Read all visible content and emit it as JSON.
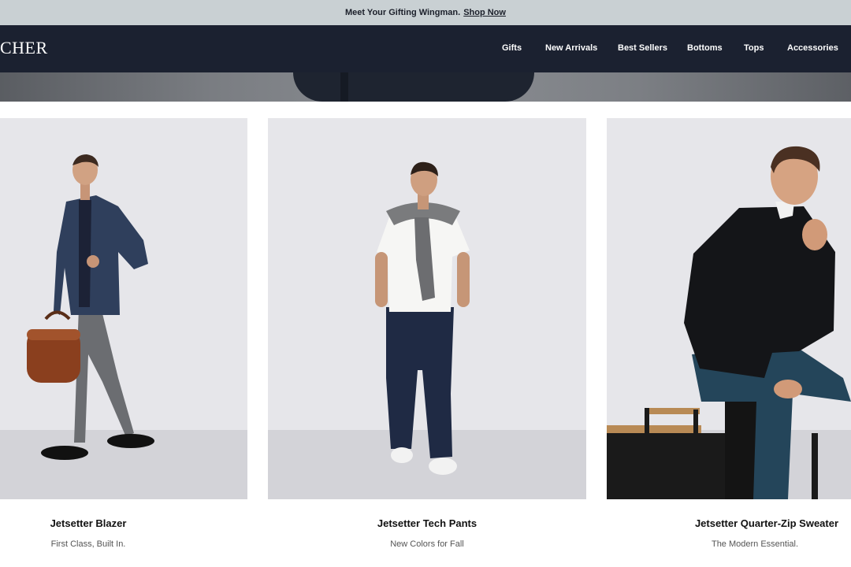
{
  "announcement": {
    "text": "Meet Your Gifting Wingman.",
    "link": "Shop Now"
  },
  "header": {
    "logo": "CHER",
    "nav": [
      "Gifts",
      "New Arrivals",
      "Best Sellers",
      "Bottoms",
      "Tops",
      "Accessories"
    ]
  },
  "products": [
    {
      "name": "Jetsetter Blazer",
      "subtitle": "First Class, Built In."
    },
    {
      "name": "Jetsetter Tech Pants",
      "subtitle": "New Colors for Fall"
    },
    {
      "name": "Jetsetter Quarter-Zip Sweater",
      "subtitle": "The Modern Essential."
    }
  ],
  "colors": {
    "announcement_bg": "#c9d0d3",
    "header_bg": "#1b2130",
    "photo_bg": "#e6e6ea"
  }
}
